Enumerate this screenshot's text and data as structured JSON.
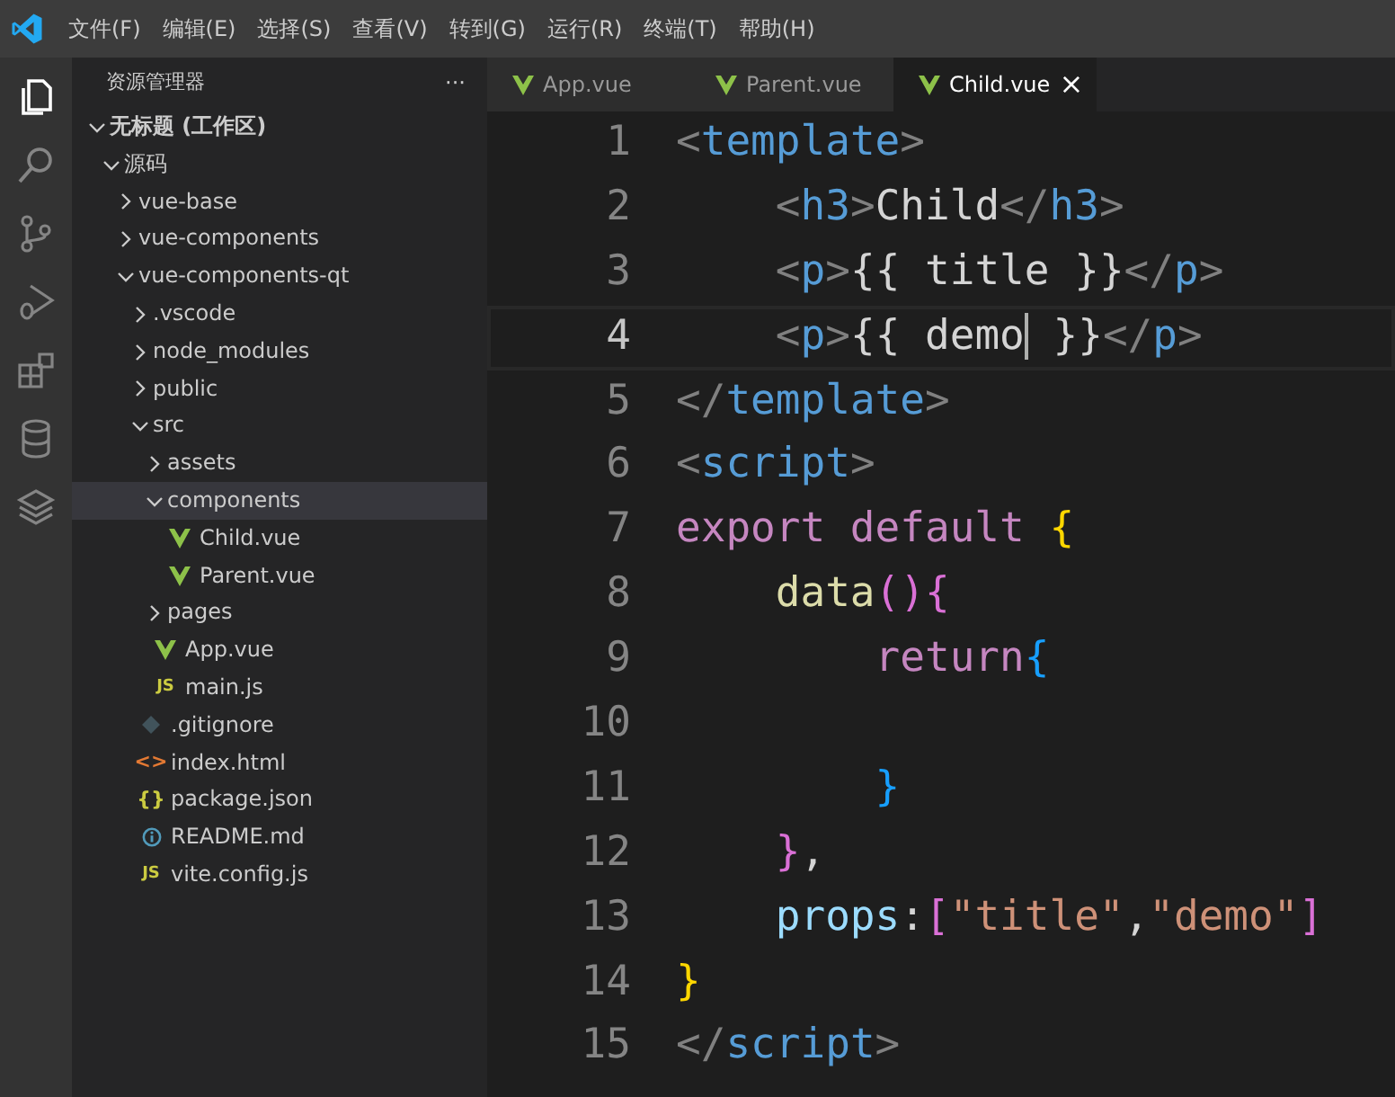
{
  "menu_bar": [
    "文件(F)",
    "编辑(E)",
    "选择(S)",
    "查看(V)",
    "转到(G)",
    "运行(R)",
    "终端(T)",
    "帮助(H)"
  ],
  "activity_bar": [
    {
      "selected": true
    },
    {
      "selected": false
    },
    {
      "selected": false
    },
    {
      "selected": false
    },
    {
      "selected": false
    },
    {
      "selected": false
    },
    {
      "selected": false
    }
  ],
  "sidebar": {
    "title": "资源管理器",
    "more": "···",
    "tree": [
      {
        "label": "无标题 (工作区)",
        "kind": "root",
        "expanded": true,
        "selected": false,
        "children": [
          {
            "label": "源码",
            "kind": "folder",
            "expanded": true,
            "selected": false,
            "children": [
              {
                "label": "vue-base",
                "kind": "folder",
                "expanded": false,
                "selected": false
              },
              {
                "label": "vue-components",
                "kind": "folder",
                "expanded": false,
                "selected": false
              },
              {
                "label": "vue-components-qt",
                "kind": "folder",
                "expanded": true,
                "selected": false,
                "children": [
                  {
                    "label": ".vscode",
                    "kind": "folder",
                    "expanded": false,
                    "selected": false
                  },
                  {
                    "label": "node_modules",
                    "kind": "folder",
                    "expanded": false,
                    "selected": false
                  },
                  {
                    "label": "public",
                    "kind": "folder",
                    "expanded": false,
                    "selected": false
                  },
                  {
                    "label": "src",
                    "kind": "folder",
                    "expanded": true,
                    "selected": false,
                    "children": [
                      {
                        "label": "assets",
                        "kind": "folder",
                        "expanded": false,
                        "selected": false
                      },
                      {
                        "label": "components",
                        "kind": "folder",
                        "expanded": true,
                        "selected": true,
                        "children": [
                          {
                            "label": "Child.vue",
                            "kind": "vue",
                            "selected": false
                          },
                          {
                            "label": "Parent.vue",
                            "kind": "vue",
                            "selected": false
                          }
                        ]
                      },
                      {
                        "label": "pages",
                        "kind": "folder",
                        "expanded": false,
                        "selected": false
                      },
                      {
                        "label": "App.vue",
                        "kind": "vue",
                        "selected": false
                      },
                      {
                        "label": "main.js",
                        "kind": "js",
                        "icon": "JS",
                        "selected": false
                      }
                    ]
                  },
                  {
                    "label": ".gitignore",
                    "kind": "git",
                    "selected": false
                  },
                  {
                    "label": "index.html",
                    "kind": "html",
                    "icon": "<>",
                    "selected": false
                  },
                  {
                    "label": "package.json",
                    "kind": "json",
                    "icon": "{}",
                    "selected": false
                  },
                  {
                    "label": "README.md",
                    "kind": "info",
                    "selected": false
                  },
                  {
                    "label": "vite.config.js",
                    "kind": "js",
                    "icon": "JS",
                    "selected": false
                  }
                ]
              }
            ]
          }
        ]
      }
    ]
  },
  "tabs": [
    {
      "label": "App.vue",
      "selected": false
    },
    {
      "label": "Parent.vue",
      "selected": false
    },
    {
      "label": "Child.vue",
      "selected": true,
      "close": "×"
    }
  ],
  "editor": {
    "lines": [
      {
        "number": "1",
        "current": false,
        "tokens": [
          {
            "kind": "punct",
            "text": "<"
          },
          {
            "kind": "tag",
            "text": "template"
          },
          {
            "kind": "punct",
            "text": ">"
          }
        ]
      },
      {
        "number": "2",
        "current": false,
        "tokens": [
          {
            "kind": "punct",
            "text": "    <"
          },
          {
            "kind": "tag",
            "text": "h3"
          },
          {
            "kind": "punct",
            "text": ">"
          },
          {
            "kind": "text",
            "text": "Child"
          },
          {
            "kind": "punct",
            "text": "</"
          },
          {
            "kind": "tag",
            "text": "h3"
          },
          {
            "kind": "punct",
            "text": ">"
          }
        ]
      },
      {
        "number": "3",
        "current": false,
        "tokens": [
          {
            "kind": "punct",
            "text": "    <"
          },
          {
            "kind": "tag",
            "text": "p"
          },
          {
            "kind": "punct",
            "text": ">"
          },
          {
            "kind": "text",
            "text": "{{ title }}"
          },
          {
            "kind": "punct",
            "text": "</"
          },
          {
            "kind": "tag",
            "text": "p"
          },
          {
            "kind": "punct",
            "text": ">"
          }
        ]
      },
      {
        "number": "4",
        "current": true,
        "tokens": [
          {
            "kind": "punct",
            "text": "    <"
          },
          {
            "kind": "tag",
            "text": "p"
          },
          {
            "kind": "punct",
            "text": ">"
          },
          {
            "kind": "text",
            "text": "{{ demo",
            "caret": true
          },
          {
            "kind": "text",
            "text": " }}"
          },
          {
            "kind": "punct",
            "text": "</"
          },
          {
            "kind": "tag",
            "text": "p"
          },
          {
            "kind": "punct",
            "text": ">"
          }
        ]
      },
      {
        "number": "5",
        "current": false,
        "tokens": [
          {
            "kind": "punct",
            "text": "</"
          },
          {
            "kind": "tag",
            "text": "template"
          },
          {
            "kind": "punct",
            "text": ">"
          }
        ]
      },
      {
        "number": "6",
        "current": false,
        "tokens": [
          {
            "kind": "punct",
            "text": "<"
          },
          {
            "kind": "tag",
            "text": "script"
          },
          {
            "kind": "punct",
            "text": ">"
          }
        ]
      },
      {
        "number": "7",
        "current": false,
        "tokens": [
          {
            "kind": "keyword",
            "text": "export default "
          },
          {
            "kind": "brace1",
            "text": "{"
          }
        ]
      },
      {
        "number": "8",
        "current": false,
        "tokens": [
          {
            "kind": "func",
            "text": "    data"
          },
          {
            "kind": "brace2",
            "text": "(){"
          }
        ]
      },
      {
        "number": "9",
        "current": false,
        "tokens": [
          {
            "kind": "keyword",
            "text": "        return"
          },
          {
            "kind": "brace3",
            "text": "{"
          }
        ]
      },
      {
        "number": "10",
        "current": false
      },
      {
        "number": "11",
        "current": false,
        "tokens": [
          {
            "kind": "brace3",
            "text": "        }"
          }
        ]
      },
      {
        "number": "12",
        "current": false,
        "tokens": [
          {
            "kind": "brace2",
            "text": "    }"
          },
          {
            "kind": "text",
            "text": ","
          }
        ]
      },
      {
        "number": "13",
        "current": false,
        "tokens": [
          {
            "kind": "prop",
            "text": "    props"
          },
          {
            "kind": "text",
            "text": ":"
          },
          {
            "kind": "brace2",
            "text": "["
          },
          {
            "kind": "string",
            "text": "\"title\""
          },
          {
            "kind": "text",
            "text": ","
          },
          {
            "kind": "string",
            "text": "\"demo\""
          },
          {
            "kind": "brace2",
            "text": "]"
          }
        ]
      },
      {
        "number": "14",
        "current": false,
        "tokens": [
          {
            "kind": "brace1",
            "text": "}"
          }
        ]
      },
      {
        "number": "15",
        "current": false,
        "tokens": [
          {
            "kind": "punct",
            "text": "</"
          },
          {
            "kind": "tag",
            "text": "script"
          },
          {
            "kind": "punct",
            "text": ">"
          }
        ]
      }
    ]
  }
}
